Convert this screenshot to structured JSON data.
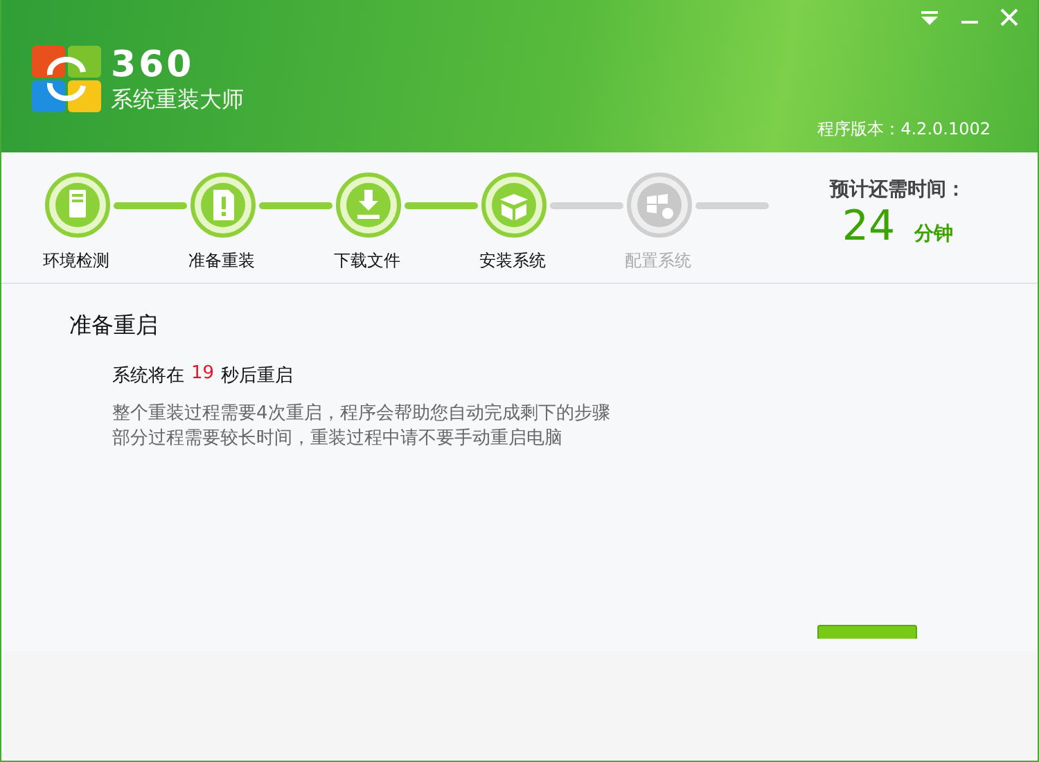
{
  "window": {
    "logo_number": "360",
    "logo_name": "系统重装大师",
    "version": "程序版本：4.2.0.1002",
    "controls": [
      {
        "kind": "menu"
      },
      {
        "kind": "minimize"
      },
      {
        "kind": "close"
      }
    ]
  },
  "steps": [
    {
      "label": "环境检测",
      "kind": "monitor",
      "done": true
    },
    {
      "label": "准备重装",
      "kind": "document",
      "done": true
    },
    {
      "label": "下载文件",
      "kind": "download",
      "done": true
    },
    {
      "label": "安装系统",
      "kind": "box",
      "done": true
    },
    {
      "label": "配置系统",
      "kind": "windows",
      "done": false
    }
  ],
  "eta": {
    "label": "预计还需时间：",
    "value": "24",
    "unit": "分钟"
  },
  "content": {
    "title": "准备重启",
    "countdown_before": "系统将在",
    "countdown": "19",
    "countdown_after": "秒后重启",
    "lines": [
      "整个重装过程需要4次重启，程序会帮助您自动完成剩下的步骤",
      "部分过程需要较长时间，重装过程中请不要手动重启电脑"
    ]
  }
}
